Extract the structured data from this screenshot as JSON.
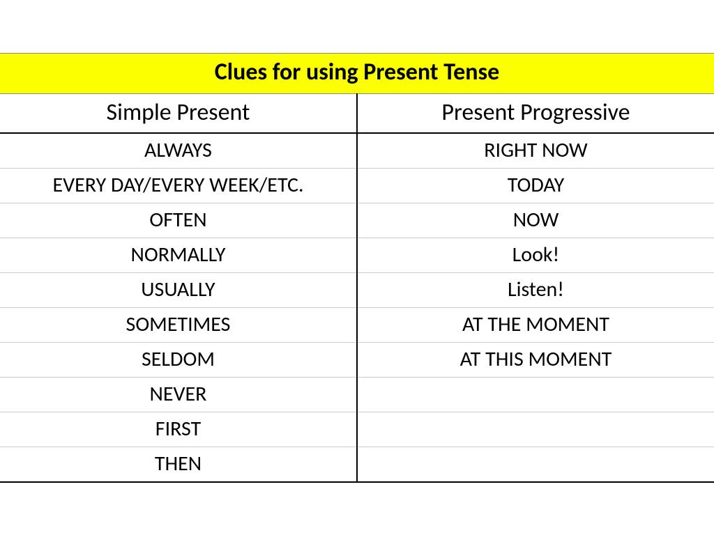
{
  "title": "Clues for using Present Tense",
  "columns": {
    "left": "Simple Present",
    "right": "Present Progressive"
  },
  "rows": [
    {
      "left": "always",
      "right": "right now",
      "leftStyle": "upper",
      "rightStyle": "upper"
    },
    {
      "left": "every day/every week/etc.",
      "right": "today",
      "leftStyle": "upper",
      "rightStyle": "upper"
    },
    {
      "left": "often",
      "right": "now",
      "leftStyle": "upper",
      "rightStyle": "upper"
    },
    {
      "left": "normally",
      "right": "Look!",
      "leftStyle": "upper",
      "rightStyle": "mixed"
    },
    {
      "left": "usually",
      "right": "Listen!",
      "leftStyle": "upper",
      "rightStyle": "mixed"
    },
    {
      "left": "sometimes",
      "right": "at the moment",
      "leftStyle": "upper",
      "rightStyle": "upper"
    },
    {
      "left": "seldom",
      "right": "at this moment",
      "leftStyle": "upper",
      "rightStyle": "upper"
    },
    {
      "left": "never",
      "right": "",
      "leftStyle": "upper",
      "rightStyle": "upper"
    },
    {
      "left": "first",
      "right": "",
      "leftStyle": "upper",
      "rightStyle": "upper"
    },
    {
      "left": "then",
      "right": "",
      "leftStyle": "upper",
      "rightStyle": "upper"
    }
  ]
}
